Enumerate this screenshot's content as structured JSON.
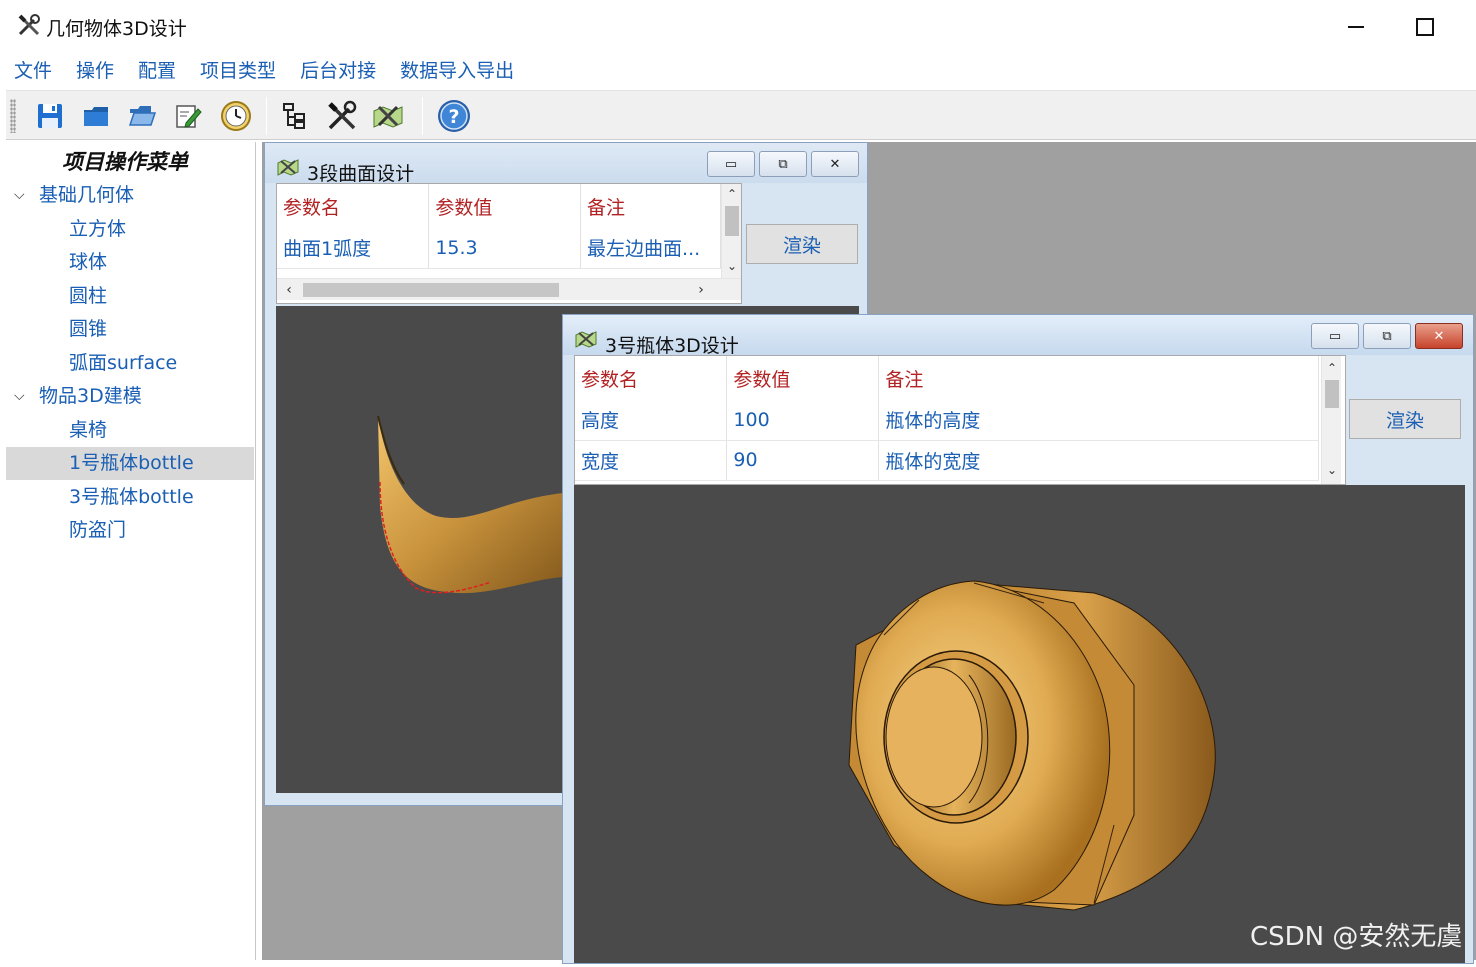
{
  "app": {
    "title": "几何物体3D设计",
    "icon": "tools-icon"
  },
  "menubar": {
    "items": [
      "文件",
      "操作",
      "配置",
      "项目类型",
      "后台对接",
      "数据导入导出"
    ]
  },
  "toolbar": {
    "buttons": [
      "save-icon",
      "folder-icon",
      "open-folder-icon",
      "edit-icon",
      "clock-icon",
      "tree-icon",
      "tools-icon",
      "tools-map-icon",
      "help-icon"
    ]
  },
  "sidebar": {
    "title": "项目操作菜单",
    "groups": [
      {
        "label": "基础几何体",
        "children": [
          "立方体",
          "球体",
          "圆柱",
          "圆锥",
          "弧面surface"
        ]
      },
      {
        "label": "物品3D建模",
        "children": [
          "桌椅",
          "1号瓶体bottle",
          "3号瓶体bottle",
          "防盗门"
        ]
      }
    ],
    "selected": "1号瓶体bottle"
  },
  "window_curve": {
    "title": "3段曲面设计",
    "headers": [
      "参数名",
      "参数值",
      "备注"
    ],
    "rows": [
      [
        "曲面1弧度",
        "15.3",
        "最左边曲面..."
      ]
    ],
    "render_label": "渲染"
  },
  "window_bottle": {
    "title": "3号瓶体3D设计",
    "headers": [
      "参数名",
      "参数值",
      "备注"
    ],
    "rows": [
      [
        "高度",
        "100",
        "瓶体的高度"
      ],
      [
        "宽度",
        "90",
        "瓶体的宽度"
      ]
    ],
    "render_label": "渲染"
  },
  "colors": {
    "link_blue": "#1a5fb4",
    "header_red": "#b22222",
    "viewport_bg": "#4a4a4a",
    "gold": "#c8923c"
  },
  "watermark": "CSDN @安然无虞"
}
